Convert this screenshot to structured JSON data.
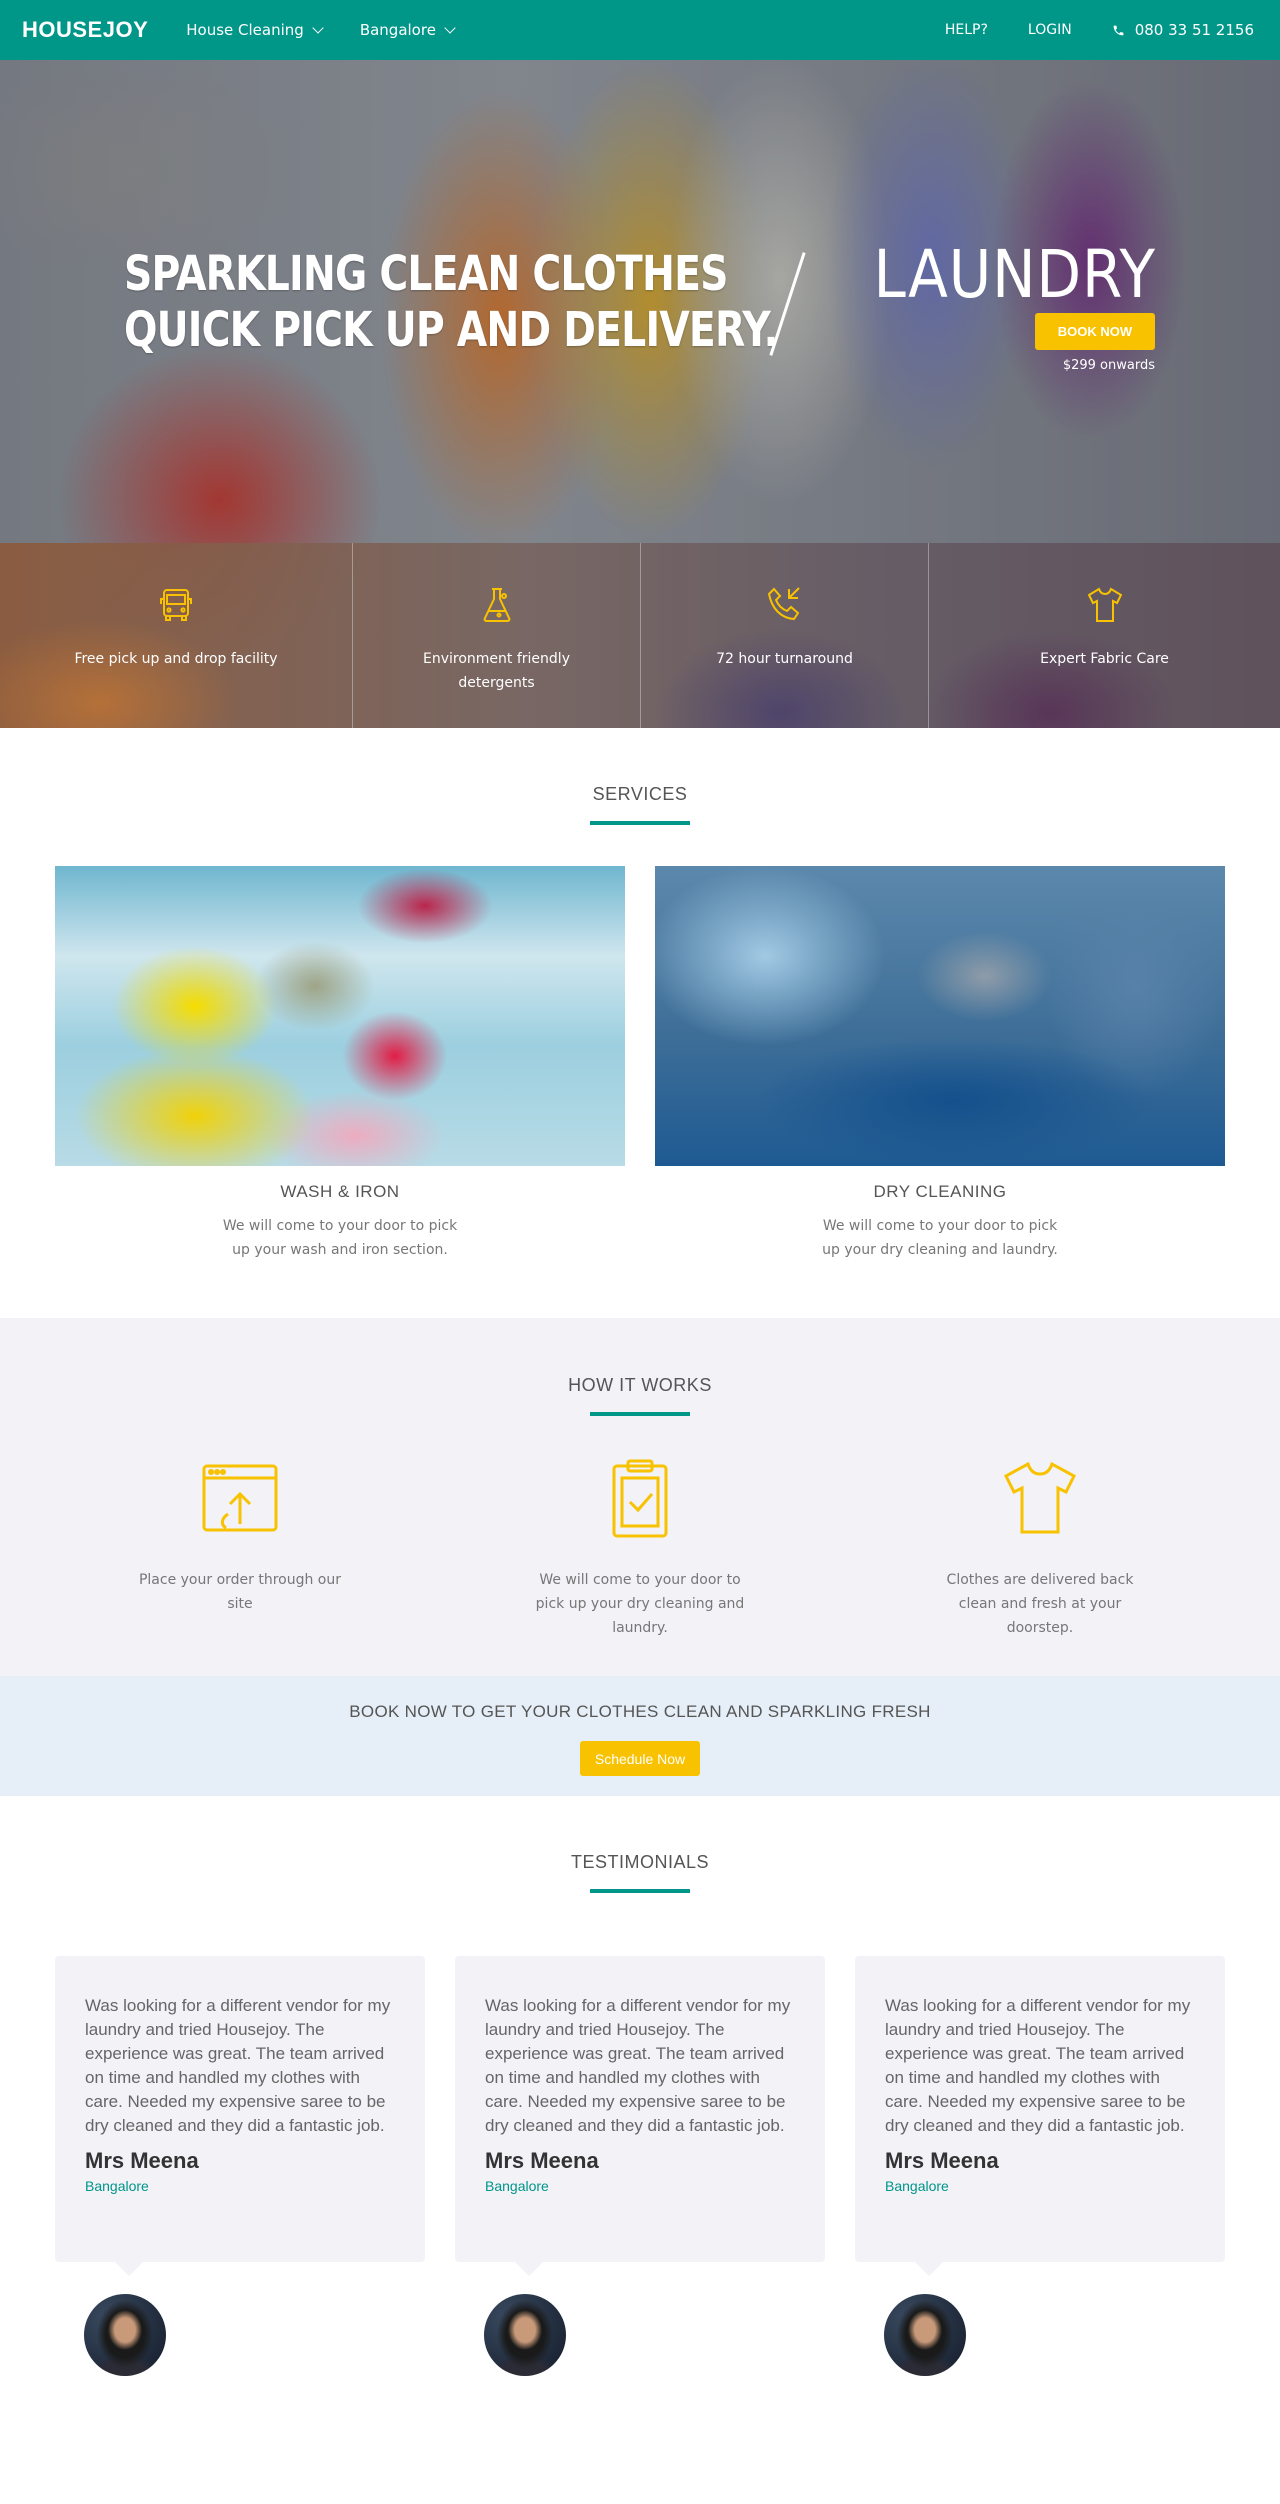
{
  "nav": {
    "logo": "HOUSEJOY",
    "service_dropdown": "House Cleaning",
    "city_dropdown": "Bangalore",
    "help": "HELP?",
    "login": "LOGIN",
    "phone": "080 33 51 2156"
  },
  "hero": {
    "headline_line1": "SPARKLING CLEAN CLOTHES",
    "headline_line2": "QUICK PICK UP AND DELIVERY.",
    "service_name": "LAUNDRY",
    "book_button": "BOOK NOW",
    "price": "$299 onwards"
  },
  "features": [
    {
      "icon": "van-icon",
      "text": "Free pick up and drop facility"
    },
    {
      "icon": "detergent-flask-icon",
      "text": "Environment friendly detergents"
    },
    {
      "icon": "phone-callback-icon",
      "text": "72 hour turnaround"
    },
    {
      "icon": "tshirt-icon",
      "text": "Expert Fabric Care"
    }
  ],
  "services": {
    "title": "SERVICES",
    "items": [
      {
        "name": "WASH & IRON",
        "desc": "We will come to your door to pick up your wash and iron section."
      },
      {
        "name": "DRY CLEANING",
        "desc": "We will come to your door to pick up your dry cleaning and laundry."
      }
    ]
  },
  "how": {
    "title": "HOW IT WORKS",
    "steps": [
      {
        "icon": "browser-upload-icon",
        "text": "Place your order through our site"
      },
      {
        "icon": "clipboard-check-icon",
        "text": "We will come to your door to pick up your dry cleaning and laundry."
      },
      {
        "icon": "tshirt-icon",
        "text": "Clothes are delivered back clean and fresh at your doorstep."
      }
    ]
  },
  "cta": {
    "text": "BOOK NOW TO GET YOUR CLOTHES CLEAN AND SPARKLING FRESH",
    "button": "Schedule Now"
  },
  "testimonials": {
    "title": "TESTIMONIALS",
    "items": [
      {
        "quote": "Was looking for a different vendor for my laundry and tried Housejoy. The experience was great. The team arrived on time and handled my clothes with care. Needed my expensive saree to be dry cleaned and they did a fantastic job.",
        "name": "Mrs Meena",
        "city": "Bangalore"
      },
      {
        "quote": "Was looking for a different vendor for my laundry and tried Housejoy. The experience was great. The team arrived on time and handled my clothes with care. Needed my expensive saree to be dry cleaned and they did a fantastic job.",
        "name": "Mrs Meena",
        "city": "Bangalore"
      },
      {
        "quote": "Was looking for a different vendor for my laundry and tried Housejoy. The experience was great. The team arrived on time and handled my clothes with care. Needed my expensive saree to be dry cleaned and they did a fantastic job.",
        "name": "Mrs Meena",
        "city": "Bangalore"
      }
    ]
  },
  "colors": {
    "brand": "#009688",
    "accent": "#f8c200",
    "section_bg": "#f2f2f7",
    "cta_bg": "#e6eff8"
  }
}
